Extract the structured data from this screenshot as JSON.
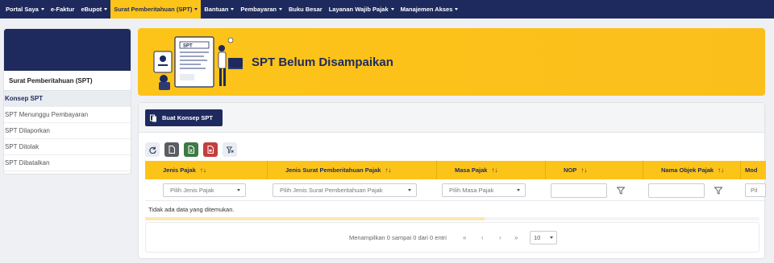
{
  "nav": {
    "items": [
      {
        "label": "Portal Saya",
        "caret": true,
        "active": false
      },
      {
        "label": "e-Faktur",
        "caret": false,
        "active": false
      },
      {
        "label": "eBupot",
        "caret": true,
        "active": false
      },
      {
        "label": "Surat Pemberitahuan (SPT)",
        "caret": true,
        "active": true
      },
      {
        "label": "Bantuan",
        "caret": true,
        "active": false
      },
      {
        "label": "Pembayaran",
        "caret": true,
        "active": false
      },
      {
        "label": "Buku Besar",
        "caret": false,
        "active": false
      },
      {
        "label": "Layanan Wajib Pajak",
        "caret": true,
        "active": false
      },
      {
        "label": "Manajemen Akses",
        "caret": true,
        "active": false
      }
    ]
  },
  "sidebar": {
    "title": "Surat Pemberitahuan (SPT)",
    "items": [
      {
        "label": "Konsep SPT",
        "active": true
      },
      {
        "label": "SPT Menunggu Pembayaran",
        "active": false
      },
      {
        "label": "SPT Dilaporkan",
        "active": false
      },
      {
        "label": "SPT Ditolak",
        "active": false
      },
      {
        "label": "SPT Dibatalkan",
        "active": false
      }
    ]
  },
  "banner": {
    "title": "SPT Belum Disampaikan",
    "illustration_label": "SPT"
  },
  "actions": {
    "create_label": "Buat Konsep SPT"
  },
  "toolbar": {
    "icons": [
      "refresh-icon",
      "document-icon",
      "excel-icon",
      "pdf-icon",
      "clear-filter-icon"
    ]
  },
  "table": {
    "columns": [
      {
        "label": "Jenis Pajak",
        "sort": "↑↓"
      },
      {
        "label": "Jenis Surat Pemberitahuan Pajak",
        "sort": "↑↓"
      },
      {
        "label": "Masa Pajak",
        "sort": "↑↓"
      },
      {
        "label": "NOP",
        "sort": "↑↓"
      },
      {
        "label": "Nama Objek Pajak",
        "sort": "↑↓"
      },
      {
        "label": "Mod",
        "sort": ""
      }
    ],
    "filters": {
      "jenis_pajak_placeholder": "Pilih Jenis Pajak",
      "jenis_spt_placeholder": "Pilih Jenis Surat Pemberitahuan Pajak",
      "masa_pajak_placeholder": "Pilih Masa Pajak",
      "last_placeholder": "Pil"
    },
    "empty_message": "Tidak ada data yang ditemukan."
  },
  "pagination": {
    "info": "Menampilkan 0 sampai 0 dari 0 entri",
    "first": "«",
    "prev": "‹",
    "next": "›",
    "last": "»",
    "page_size": "10"
  },
  "colors": {
    "navy": "#1e2a5e",
    "accent": "#fcc419"
  }
}
